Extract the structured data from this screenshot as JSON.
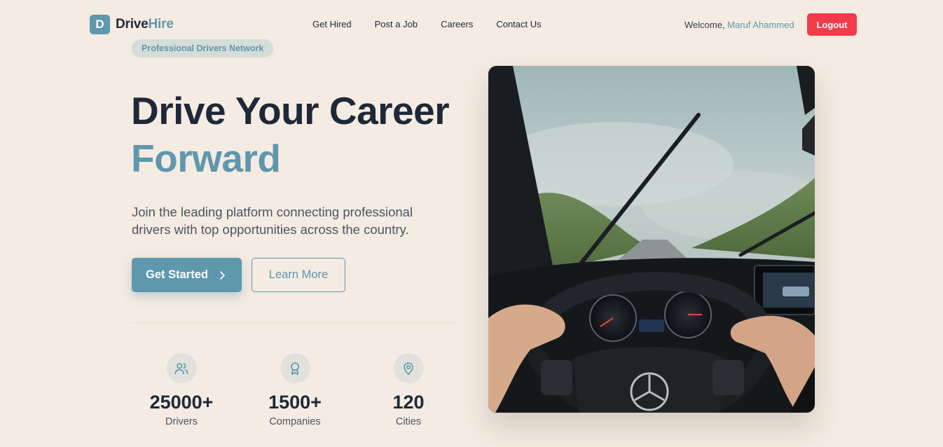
{
  "brand": {
    "letter": "D",
    "name_part1": "Drive",
    "name_part2": "Hire"
  },
  "nav": {
    "items": [
      "Get Hired",
      "Post a Job",
      "Careers",
      "Contact Us"
    ]
  },
  "user": {
    "welcome": "Welcome, ",
    "name": "Maruf Ahammed",
    "logout_label": "Logout"
  },
  "hero": {
    "badge": "Professional Drivers Network",
    "title_line1": "Drive Your Career",
    "title_line2": "Forward",
    "description": "Join the leading platform connecting professional drivers with top opportunities across the country.",
    "primary_cta": "Get Started",
    "secondary_cta": "Learn More"
  },
  "stats": [
    {
      "icon": "users-icon",
      "value": "25000+",
      "label": "Drivers"
    },
    {
      "icon": "award-icon",
      "value": "1500+",
      "label": "Companies"
    },
    {
      "icon": "map-pin-icon",
      "value": "120",
      "label": "Cities"
    }
  ],
  "colors": {
    "accent": "#5f98ad",
    "logout": "#f23a4a",
    "background": "#f4ebe2",
    "heading": "#1e2838"
  }
}
